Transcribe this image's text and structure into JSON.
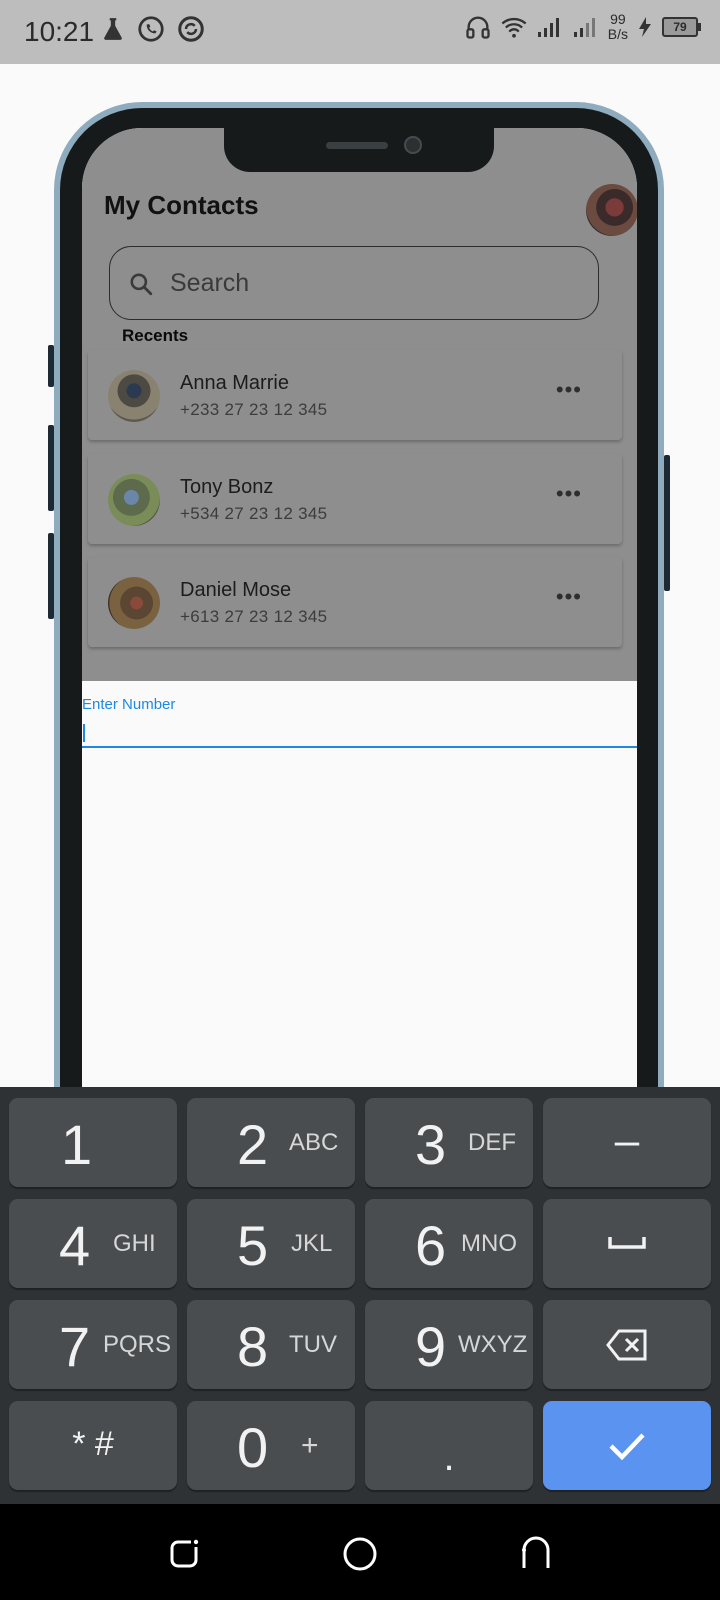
{
  "status_bar": {
    "time": "10:21",
    "net_speed_value": "99",
    "net_speed_unit": "B/s",
    "battery": "79",
    "icons": [
      "flask-icon",
      "whatsapp-icon",
      "sync-icon",
      "headphones-icon",
      "wifi-icon",
      "signal-icon",
      "signal-icon",
      "charging-icon",
      "battery-icon"
    ]
  },
  "app": {
    "title": "My Contacts",
    "search_placeholder": "Search",
    "recents_label": "Recents",
    "contacts": [
      {
        "name": "Anna Marrie",
        "phone": "+233 27 23 12 345"
      },
      {
        "name": "Tony Bonz",
        "phone": "+534 27 23 12 345"
      },
      {
        "name": "Daniel Mose",
        "phone": "+613 27 23 12 345"
      }
    ],
    "more_label": "•••",
    "number_field": {
      "label": "Enter Number",
      "value": ""
    }
  },
  "keypad": {
    "keys": [
      {
        "digit": "1",
        "letters": ""
      },
      {
        "digit": "2",
        "letters": "ABC"
      },
      {
        "digit": "3",
        "letters": "DEF"
      },
      {
        "digit": "4",
        "letters": "GHI"
      },
      {
        "digit": "5",
        "letters": "JKL"
      },
      {
        "digit": "6",
        "letters": "MNO"
      },
      {
        "digit": "7",
        "letters": "PQRS"
      },
      {
        "digit": "8",
        "letters": "TUV"
      },
      {
        "digit": "9",
        "letters": "WXYZ"
      },
      {
        "digit": "0",
        "letters": "+"
      }
    ],
    "dash": "–",
    "space": "␣",
    "star_hash": "* #",
    "dot": ".",
    "icons": {
      "backspace": "backspace-icon",
      "confirm": "check-icon"
    }
  },
  "nav_bar": {
    "icons": [
      "recents-icon",
      "home-icon",
      "back-icon"
    ]
  },
  "colors": {
    "accent": "#1e88e5",
    "confirm_key": "#5a93f0",
    "keypad_bg": "#2f3235",
    "key_bg": "#4a4d50"
  }
}
